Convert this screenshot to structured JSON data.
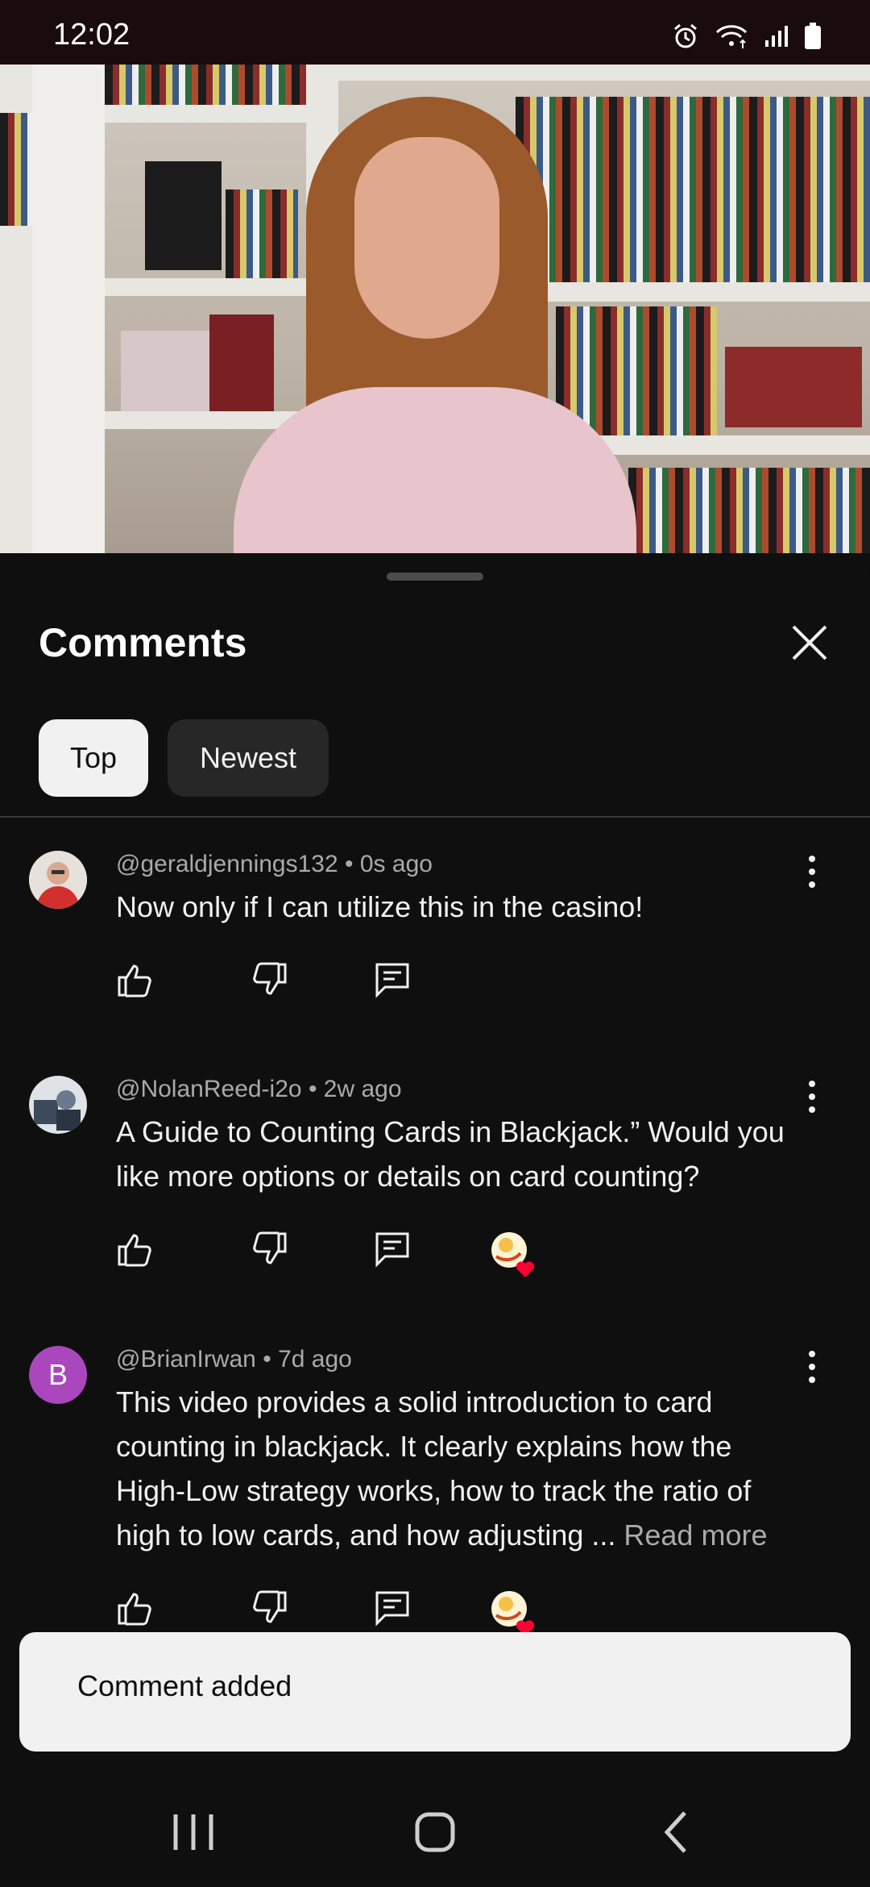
{
  "status_bar": {
    "time": "12:02",
    "icons": [
      "alarm-icon",
      "wifi-icon",
      "signal-icon",
      "battery-icon"
    ]
  },
  "video": {
    "progress_fraction": 0.08
  },
  "comments_panel": {
    "title": "Comments",
    "sort_chips": [
      {
        "label": "Top",
        "selected": true
      },
      {
        "label": "Newest",
        "selected": false
      }
    ],
    "comments": [
      {
        "author": "@geraldjennings132",
        "age": "0s ago",
        "text": "Now only if I can utilize this in the casino!",
        "creator_heart": false,
        "avatar_letter": "",
        "avatar_color": "#c62828"
      },
      {
        "author": "@NolanReed-i2o",
        "age": "2w ago",
        "text": "A Guide to Counting Cards in Blackjack.” Would you like more options or details on card counting?",
        "creator_heart": true,
        "avatar_letter": "",
        "avatar_color": "#5a6a7a"
      },
      {
        "author": "@BrianIrwan",
        "age": "7d ago",
        "text": "This video provides a solid introduction to card counting in blackjack. It clearly explains how the High-Low strategy works, how to track the ratio of high to low cards, and how adjusting ...",
        "read_more": "Read more",
        "creator_heart": true,
        "avatar_letter": "B",
        "avatar_color": "#ab47bc"
      }
    ],
    "separator": "•"
  },
  "toast": {
    "message": "Comment added"
  },
  "nav_bar": {
    "buttons": [
      "recents-button",
      "home-button",
      "back-button"
    ]
  },
  "colors": {
    "background": "#0f0f0f",
    "text_primary": "#f1f1f1",
    "text_secondary": "#aaaaaa",
    "chip_selected_bg": "#f1f1f1",
    "chip_bg": "#272727",
    "heart": "#ff0033"
  }
}
